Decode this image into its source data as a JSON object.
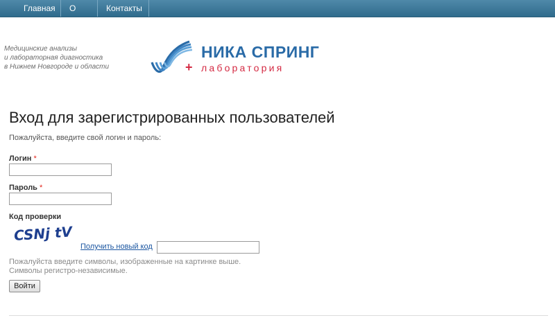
{
  "nav": {
    "items": [
      {
        "label": "Главная"
      },
      {
        "label": "О нас"
      },
      {
        "label": "Контакты"
      }
    ]
  },
  "header": {
    "tagline": [
      "Медицинские анализы",
      "и лабораторная диагностика",
      "в Нижнем Новгороде и области"
    ],
    "logo": {
      "title": "НИКА СПРИНГ",
      "subtitle": "лаборатория",
      "plus": "+",
      "colors": {
        "blue": "#2a6ba7",
        "red": "#d42a43"
      }
    }
  },
  "form": {
    "title": "Вход для зарегистрированных пользователей",
    "intro": "Пожалуйста, введите свой логин и пароль:",
    "login_label": "Логин",
    "password_label": "Пароль",
    "required_mark": "*",
    "login_value": "",
    "password_value": "",
    "captcha_label": "Код проверки",
    "captcha_text": "CSNj tV",
    "captcha_refresh": "Получить новый код",
    "captcha_value": "",
    "hint": [
      "Пожалуйста введите символы, изображенные на картинке выше.",
      "Символы регистро-независимые."
    ],
    "submit_label": "Войти"
  }
}
